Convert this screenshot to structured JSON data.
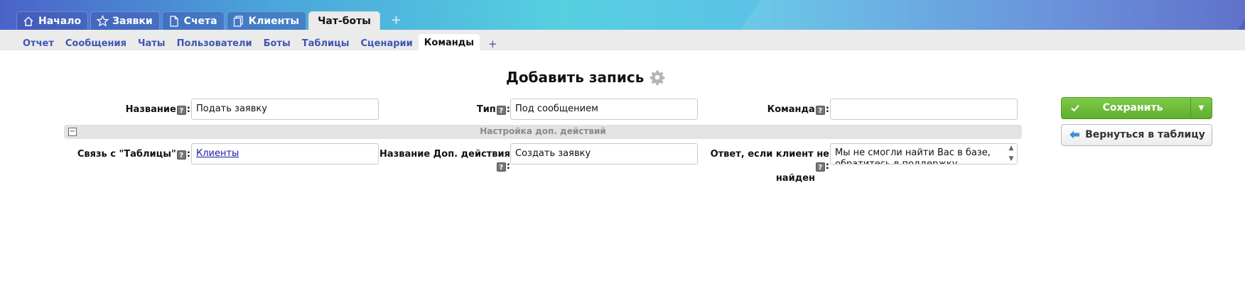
{
  "top_tabs": [
    {
      "label": "Начало",
      "icon": "home-icon"
    },
    {
      "label": "Заявки",
      "icon": "star-icon"
    },
    {
      "label": "Счета",
      "icon": "document-icon"
    },
    {
      "label": "Клиенты",
      "icon": "copy-icon"
    },
    {
      "label": "Чат-боты",
      "active": true
    }
  ],
  "top_tabs_add": "+",
  "sub_tabs": [
    {
      "label": "Отчет"
    },
    {
      "label": "Сообщения"
    },
    {
      "label": "Чаты"
    },
    {
      "label": "Пользователи"
    },
    {
      "label": "Боты"
    },
    {
      "label": "Таблицы"
    },
    {
      "label": "Сценарии"
    },
    {
      "label": "Команды",
      "active": true
    }
  ],
  "sub_tabs_add": "+",
  "form": {
    "title": "Добавить запись",
    "help_mark": "?",
    "colon": ":",
    "name_label": "Название",
    "name_value": "Подать заявку",
    "type_label": "Тип",
    "type_value": "Под сообщением",
    "command_label": "Команда",
    "command_value": "",
    "section_title": "Настройка доп. действий",
    "section_toggle": "−",
    "link_label": "Связь с \"Таблицы\"",
    "link_value": "Клиенты",
    "action_name_label": "Название Доп. действия",
    "action_name_value": "Создать заявку",
    "not_found_label_1": "Ответ, если клиент не",
    "not_found_label_2": "найден",
    "not_found_value_1": "Мы не смогли найти Вас в базе,",
    "not_found_value_2": "обратитесь в поддержку"
  },
  "buttons": {
    "save": "Сохранить",
    "save_dropdown": "▼",
    "back": "Вернуться в таблицу"
  },
  "colors": {
    "accent_blue": "#4055b5",
    "save_green": "#6cbb38"
  }
}
